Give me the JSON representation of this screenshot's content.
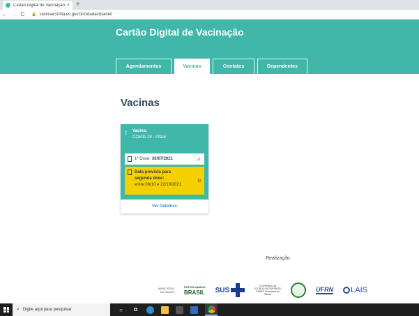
{
  "browser": {
    "tab_title": "Cartão Digital de Vacinação - Va",
    "tab_close": "×",
    "new_tab": "+",
    "url": "vacinaeconfia.es.gov.br/cidadao/painel/",
    "back": "←",
    "forward": "→",
    "reload": "C",
    "lock": "🔒"
  },
  "header": {
    "title": "Cartão Digital de Vacinação",
    "tabs": [
      {
        "label": "Agendamentos",
        "active": false
      },
      {
        "label": "Vacinas",
        "active": true
      },
      {
        "label": "Contatos",
        "active": false
      },
      {
        "label": "Dependentes",
        "active": false
      }
    ]
  },
  "main": {
    "title": "Vacinas",
    "card": {
      "vaccine_label": "Vacina:",
      "vaccine_name": "COVID-19 - Pfizer",
      "dose_label": "1ª Dose:",
      "dose_date": "30/07/2021",
      "dose_check": "✓",
      "next_label_line1": "Data prevista para",
      "next_label_line2": "segunda dose:",
      "next_range": "entre 08/10 e 22/10/2021",
      "details_link": "Ver Detalhes",
      "colors": {
        "card": "#40b7a9",
        "pending": "#f5d000",
        "link": "#3a8ed3"
      }
    }
  },
  "footer": {
    "realizacao": "Realização",
    "ministerio": "MINISTÉRIO DA SAÚDE",
    "brasil": "BRASIL",
    "patria": "PÁTRIA AMADA",
    "sus": "SUS",
    "governo_es": "GOVERNO DO ESTADO DO ESPÍRITO SANTO Secretaria da Saúde",
    "ufrn": "UFRN",
    "lais": "LAIS"
  },
  "taskbar": {
    "search_placeholder": "Digite aqui para pesquisar",
    "icons": [
      "windows-icon",
      "search-icon",
      "task-view-icon",
      "edge-icon",
      "file-explorer-icon",
      "store-icon",
      "mail-icon",
      "chrome-icon"
    ]
  }
}
